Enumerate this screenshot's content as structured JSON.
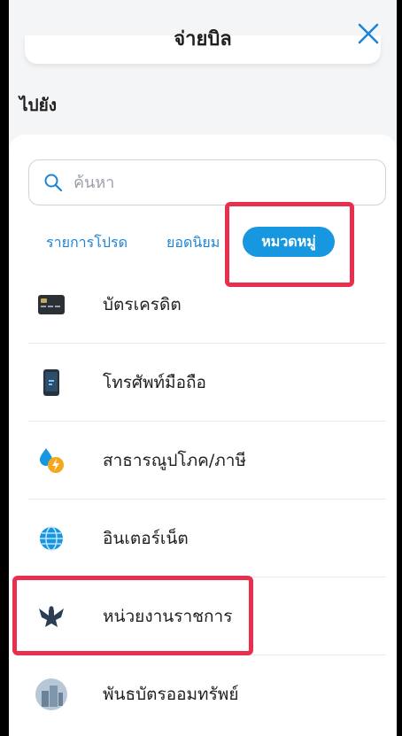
{
  "header": {
    "title": "จ่ายบิล"
  },
  "section_label": "ไปยัง",
  "search": {
    "placeholder": "ค้นหา"
  },
  "tabs": [
    {
      "label": "รายการโปรด",
      "active": false
    },
    {
      "label": "ยอดนิยม",
      "active": false
    },
    {
      "label": "หมวดหมู่",
      "active": true
    }
  ],
  "categories": [
    {
      "label": "บัตรเครดิต",
      "icon": "credit-card-icon"
    },
    {
      "label": "โทรศัพท์มือถือ",
      "icon": "mobile-phone-icon"
    },
    {
      "label": "สาธารณูปโภค/ภาษี",
      "icon": "utility-water-electric-icon"
    },
    {
      "label": "อินเตอร์เน็ต",
      "icon": "globe-icon"
    },
    {
      "label": "หน่วยงานราชการ",
      "icon": "garuda-emblem-icon"
    },
    {
      "label": "พันธบัตรออมทรัพย์",
      "icon": "building-icon"
    }
  ],
  "colors": {
    "accent": "#1797e0",
    "highlight": "#e8304e"
  }
}
